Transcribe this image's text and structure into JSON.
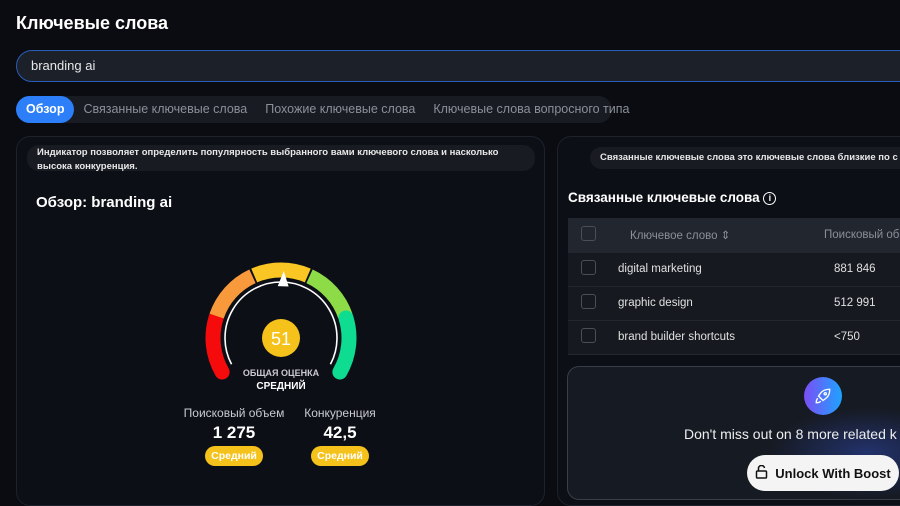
{
  "header": {
    "title": "Ключевые слова"
  },
  "search": {
    "value": "branding ai"
  },
  "tabs": [
    {
      "label": "Обзор"
    },
    {
      "label": "Связанные ключевые слова"
    },
    {
      "label": "Похожие ключевые слова"
    },
    {
      "label": "Ключевые слова вопросного типа"
    }
  ],
  "overview": {
    "hint": "Индикатор позволяет определить популярность выбранного вами ключевого слова и насколько высока конкуренция.",
    "title": "Обзор: branding ai",
    "score": "51",
    "score_label": "ОБЩАЯ ОЦЕНКА",
    "score_level": "СРЕДНИЙ",
    "score_fraction": 0.51,
    "gauge_colors": [
      "#f50b0b",
      "#f89a3c",
      "#f9c623",
      "#8edb48",
      "#0ddc91"
    ],
    "volume_label": "Поисковый объем",
    "volume": "1 275",
    "volume_badge": "Средний",
    "competition_label": "Конкуренция",
    "competition": "42,5",
    "competition_badge": "Средний"
  },
  "related": {
    "hint": "Связанные ключевые слова это ключевые слова близкие по с",
    "title": "Связанные ключевые слова",
    "columns": [
      "Ключевое слово",
      "Поисковый об"
    ],
    "rows": [
      {
        "keyword": "digital marketing",
        "volume": "881 846"
      },
      {
        "keyword": "graphic design",
        "volume": "512 991"
      },
      {
        "keyword": "brand builder shortcuts",
        "volume": "<750"
      }
    ],
    "promo": "Don't miss out on 8 more related k",
    "unlock": "Unlock With Boost"
  }
}
